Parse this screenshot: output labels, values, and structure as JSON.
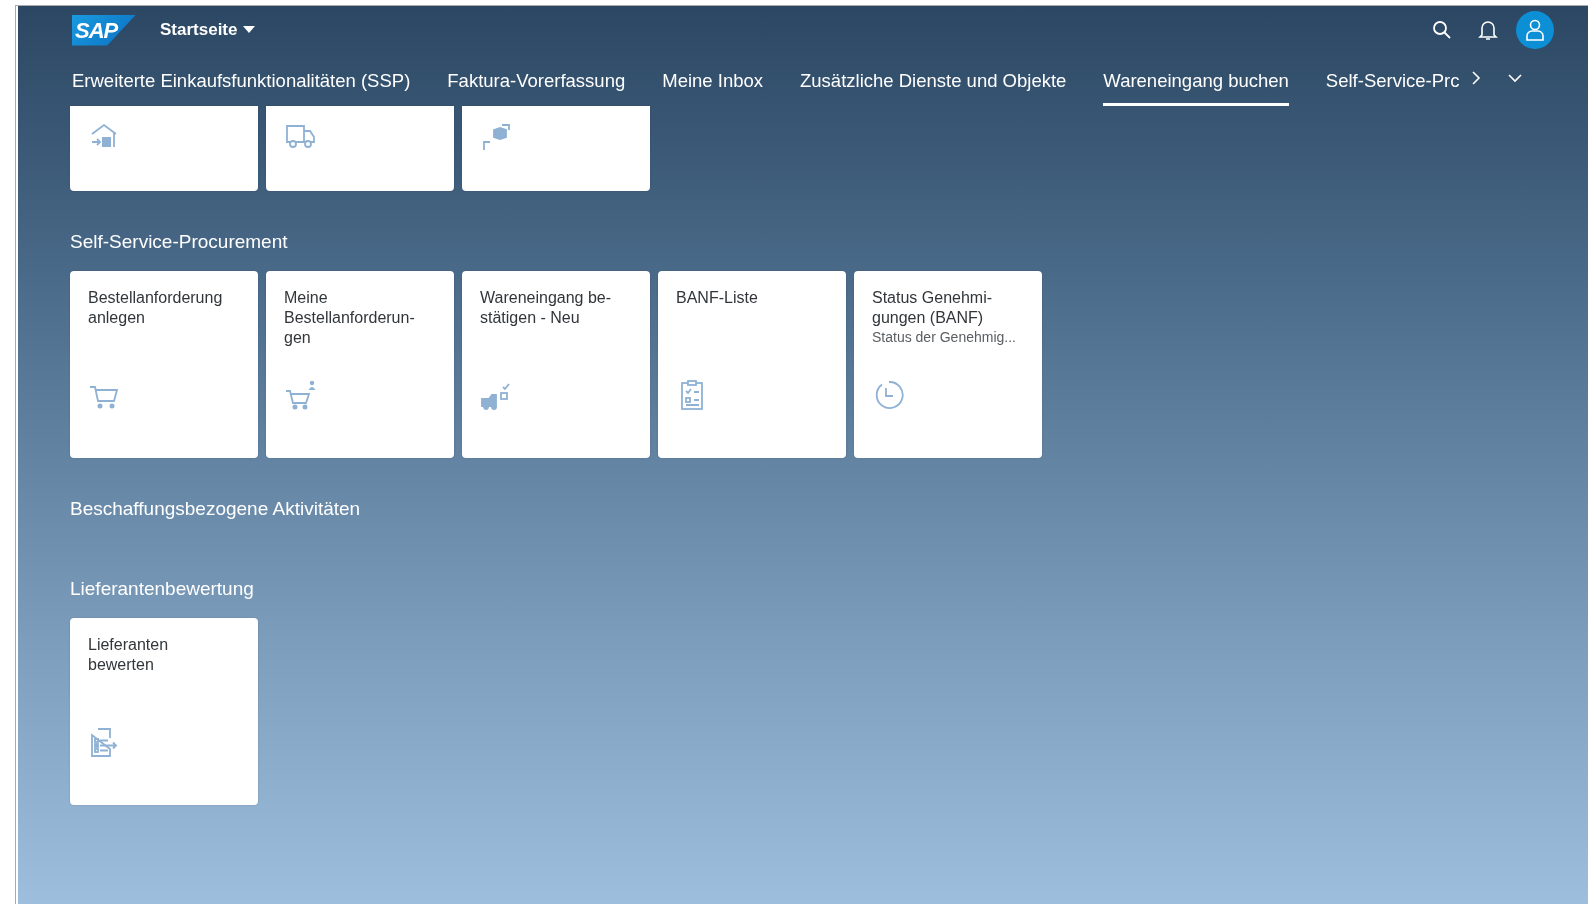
{
  "shell": {
    "logo": "SAP",
    "title": "Startseite"
  },
  "tabs": [
    {
      "label": "Erweiterte Einkaufsfunktionalitäten (SSP)",
      "selected": false
    },
    {
      "label": "Faktura-Vorerfassung",
      "selected": false
    },
    {
      "label": "Meine Inbox",
      "selected": false
    },
    {
      "label": "Zusätzliche Dienste und Objekte",
      "selected": false
    },
    {
      "label": "Wareneingang buchen",
      "selected": true
    },
    {
      "label": "Self-Service-Prc",
      "selected": false
    }
  ],
  "groups": [
    {
      "tiles": [
        {
          "kind": "warehouse"
        },
        {
          "kind": "truck"
        },
        {
          "kind": "transfer"
        }
      ]
    },
    {
      "title": "Self-Service-Procurement",
      "tiles": [
        {
          "title": "Bestellanforderung\nanlegen",
          "kind": "cart"
        },
        {
          "title": "Meine\nBestellanforderun-\ngen",
          "kind": "cartperson"
        },
        {
          "title": "Wareneingang be-\nstätigen - Neu",
          "kind": "truckcheck"
        },
        {
          "title": "BANF-Liste",
          "kind": "checklist"
        },
        {
          "title": "Status Genehmi-\ngungen (BANF)",
          "subtitle": "Status der Genehmig...",
          "kind": "clock"
        }
      ]
    },
    {
      "title": "Beschaffungsbezogene Aktivitäten"
    },
    {
      "title": "Lieferantenbewertung",
      "tiles": [
        {
          "title": "Lieferanten\nbewerten",
          "kind": "listarrow"
        }
      ]
    }
  ]
}
